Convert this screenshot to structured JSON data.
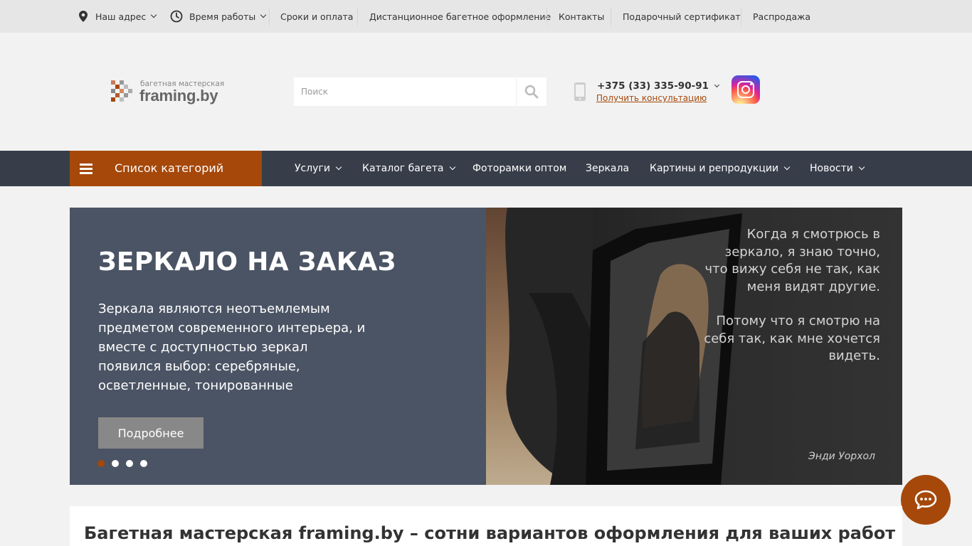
{
  "colors": {
    "accent": "#a5480a",
    "nav_bg": "#373e4a",
    "hero_bg": "#4b5464",
    "topbar_bg": "#e6e6e6",
    "page_bg": "#f2f2f2"
  },
  "topbar": {
    "address": "Наш адрес",
    "hours": "Время работы",
    "links": [
      "Сроки и оплата",
      "Дистанционное багетное оформление",
      "Контакты",
      "Подарочный сертификат",
      "Распродажа"
    ]
  },
  "header": {
    "logo_tagline": "багетная мастерская",
    "logo_name": "framing.by",
    "search_placeholder": "Поиск",
    "phone": "+375 (33) 335-90-91",
    "consult": "Получить консультацию",
    "social_icon": "instagram-icon"
  },
  "nav": {
    "catalog_button": "Список категорий",
    "items": [
      "Услуги",
      "Каталог багета",
      "Фоторамки оптом",
      "Зеркала",
      "Картины и репродукции",
      "Новости"
    ]
  },
  "hero": {
    "title": "ЗЕРКАЛО НА ЗАКАЗ",
    "description": "Зеркала являются неотъемлемым предметом современного интерьера, и вместе с доступностью зеркал появился выбор: серебряные, осветленные, тонированные",
    "button": "Подробнее",
    "slide_count": 4,
    "active_slide": 1,
    "quote_part1": "Когда я смотрюсь в зеркало, я знаю точно, что вижу себя не так, как меня видят другие.",
    "quote_part2": "Потому что я смотрю на себя так, как мне хочется видеть.",
    "quote_author": "Энди Уорхол"
  },
  "content": {
    "heading": "Багетная мастерская framing.by – сотни вариантов оформления для ваших работ"
  }
}
